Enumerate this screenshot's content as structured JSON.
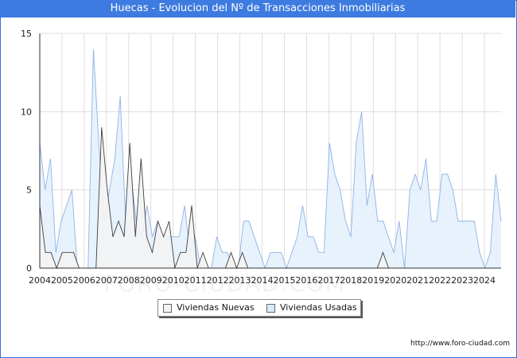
{
  "title": "Huecas - Evolucion del Nº de Transacciones Inmobiliarias",
  "source_url": "http://www.foro-ciudad.com",
  "watermark": "FORO-CIUDAD.COM",
  "colors": {
    "title_bar": "#3d7be0",
    "nuevas_fill": "#f3f3f3",
    "nuevas_line": "#404040",
    "usadas_fill": "#e3f0fb",
    "usadas_line": "#8fb3e6",
    "grid": "#dddddd"
  },
  "chart_data": {
    "type": "area",
    "title": "Huecas - Evolucion del Nº de Transacciones Inmobiliarias",
    "xlabel": "",
    "ylabel": "",
    "ylim": [
      0,
      15
    ],
    "yticks": [
      0,
      5,
      10,
      15
    ],
    "xlim": [
      2004,
      2024.75
    ],
    "xticks": [
      "2004",
      "2005",
      "2006",
      "2007",
      "2008",
      "2009",
      "2010",
      "2011",
      "2012",
      "2013",
      "2014",
      "2015",
      "2016",
      "2017",
      "2018",
      "2019",
      "2020",
      "2021",
      "2022",
      "2023",
      "2024"
    ],
    "grid": true,
    "legend_position": "bottom-center",
    "x_start": "2004 Q1",
    "frequency": "quarterly",
    "series": [
      {
        "name": "Viviendas Nuevas",
        "values": [
          4,
          1,
          1,
          0,
          1,
          1,
          1,
          0,
          0,
          0,
          0,
          9,
          5,
          2,
          3,
          2,
          8,
          2,
          7,
          2,
          1,
          3,
          2,
          3,
          0,
          1,
          1,
          4,
          0,
          1,
          0,
          0,
          0,
          0,
          1,
          0,
          1,
          0,
          0,
          0,
          0,
          0,
          0,
          0,
          0,
          0,
          0,
          0,
          0,
          0,
          0,
          0,
          0,
          0,
          0,
          0,
          0,
          0,
          0,
          0,
          0,
          1,
          0,
          0,
          0,
          0,
          0,
          0,
          0,
          0,
          0,
          0,
          0,
          0,
          0,
          0,
          0,
          0,
          0,
          0,
          0,
          0,
          0
        ]
      },
      {
        "name": "Viviendas Usadas",
        "values": [
          8,
          5,
          7,
          1,
          3,
          4,
          5,
          0,
          0,
          0,
          14,
          8,
          3,
          5,
          7,
          11,
          3,
          6,
          3,
          2,
          4,
          2,
          3,
          2,
          2,
          2,
          2,
          4,
          1,
          2,
          0,
          0,
          0,
          2,
          1,
          1,
          0,
          0,
          3,
          3,
          2,
          1,
          0,
          1,
          1,
          1,
          0,
          1,
          2,
          4,
          2,
          2,
          1,
          1,
          8,
          6,
          5,
          3,
          2,
          8,
          10,
          4,
          6,
          3,
          3,
          2,
          1,
          3,
          0,
          5,
          6,
          5,
          7,
          3,
          3,
          6,
          6,
          5,
          3,
          3,
          3,
          3,
          1,
          0,
          1,
          6,
          3
        ]
      }
    ]
  }
}
